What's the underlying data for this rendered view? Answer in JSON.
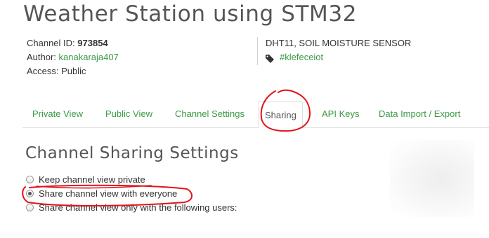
{
  "page": {
    "title": "Weather Station using STM32"
  },
  "channel_info": {
    "channel_id_label": "Channel ID:",
    "channel_id_value": "973854",
    "author_label": "Author:",
    "author_value": "kanakaraja407",
    "access_label": "Access:",
    "access_value": "Public",
    "description": "DHT11, SOIL MOISTURE SENSOR",
    "tag": "#klefeceiot",
    "tag_icon": "tag-icon"
  },
  "tabs": [
    {
      "label": "Private View",
      "active": false
    },
    {
      "label": "Public View",
      "active": false
    },
    {
      "label": "Channel Settings",
      "active": false
    },
    {
      "label": "Sharing",
      "active": true
    },
    {
      "label": "API Keys",
      "active": false
    },
    {
      "label": "Data Import / Export",
      "active": false
    }
  ],
  "sharing": {
    "heading": "Channel Sharing Settings",
    "options": [
      {
        "label": "Keep channel view private",
        "selected": false
      },
      {
        "label": "Share channel view with everyone",
        "selected": true
      },
      {
        "label": "Share channel view only with the following users:",
        "selected": false
      }
    ]
  },
  "colors": {
    "link_green": "#3b9a45",
    "annotation_red": "#e0141b"
  }
}
